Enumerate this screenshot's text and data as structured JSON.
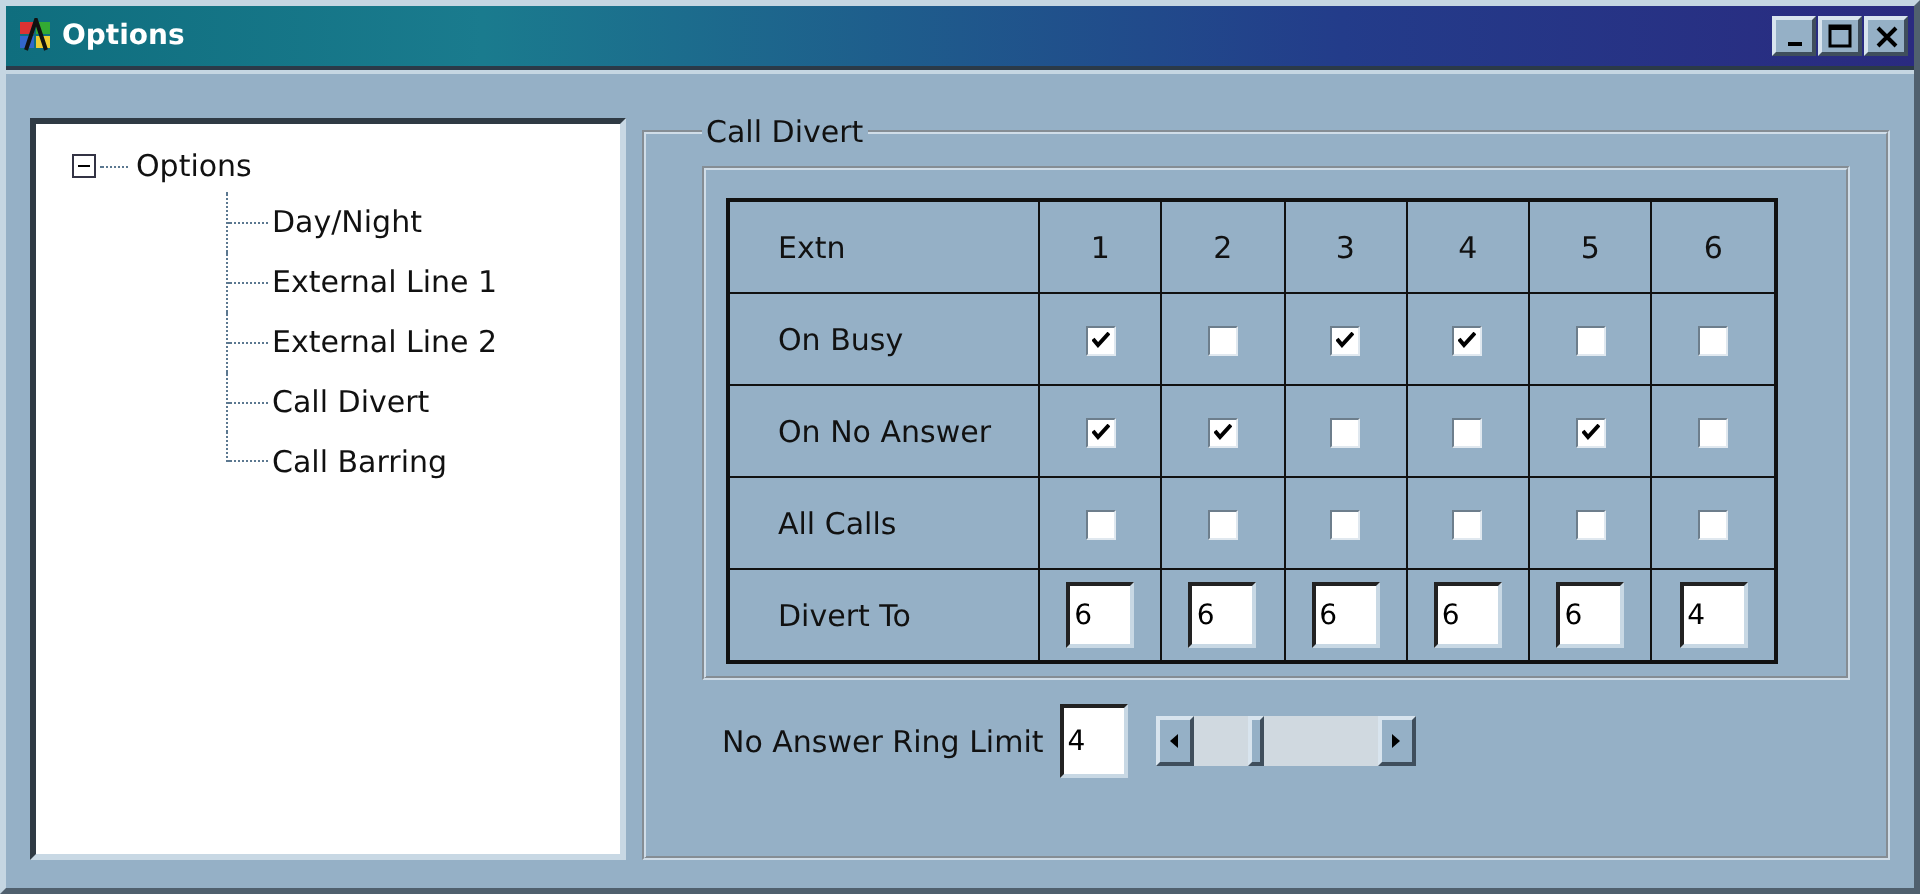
{
  "window": {
    "title": "Options"
  },
  "tree": {
    "label": "Options",
    "expanded": true,
    "children": [
      {
        "label": "Day/Night"
      },
      {
        "label": "External Line 1"
      },
      {
        "label": "External Line 2"
      },
      {
        "label": "Call Divert"
      },
      {
        "label": "Call Barring"
      }
    ]
  },
  "group": {
    "title": "Call Divert"
  },
  "table": {
    "header": "Extn",
    "columns": [
      "1",
      "2",
      "3",
      "4",
      "5",
      "6"
    ],
    "rows": [
      {
        "label": "On Busy",
        "kind": "checkbox",
        "cells": [
          {
            "checked": true
          },
          {
            "checked": false
          },
          {
            "checked": true
          },
          {
            "checked": true
          },
          {
            "checked": false
          },
          {
            "checked": false
          }
        ]
      },
      {
        "label": "On No Answer",
        "kind": "checkbox",
        "cells": [
          {
            "checked": true
          },
          {
            "checked": true
          },
          {
            "checked": false
          },
          {
            "checked": false
          },
          {
            "checked": true
          },
          {
            "checked": false
          }
        ]
      },
      {
        "label": "All Calls",
        "kind": "checkbox",
        "cells": [
          {
            "checked": false
          },
          {
            "checked": false
          },
          {
            "checked": false
          },
          {
            "checked": false
          },
          {
            "checked": false
          },
          {
            "checked": false
          }
        ]
      },
      {
        "label": "Divert To",
        "kind": "field",
        "cells": [
          {
            "value": "6"
          },
          {
            "value": "6"
          },
          {
            "value": "6"
          },
          {
            "value": "6"
          },
          {
            "value": "6"
          },
          {
            "value": "4"
          }
        ]
      }
    ]
  },
  "ring_limit": {
    "label": "No Answer Ring Limit",
    "value": "4",
    "level": 0.33
  }
}
